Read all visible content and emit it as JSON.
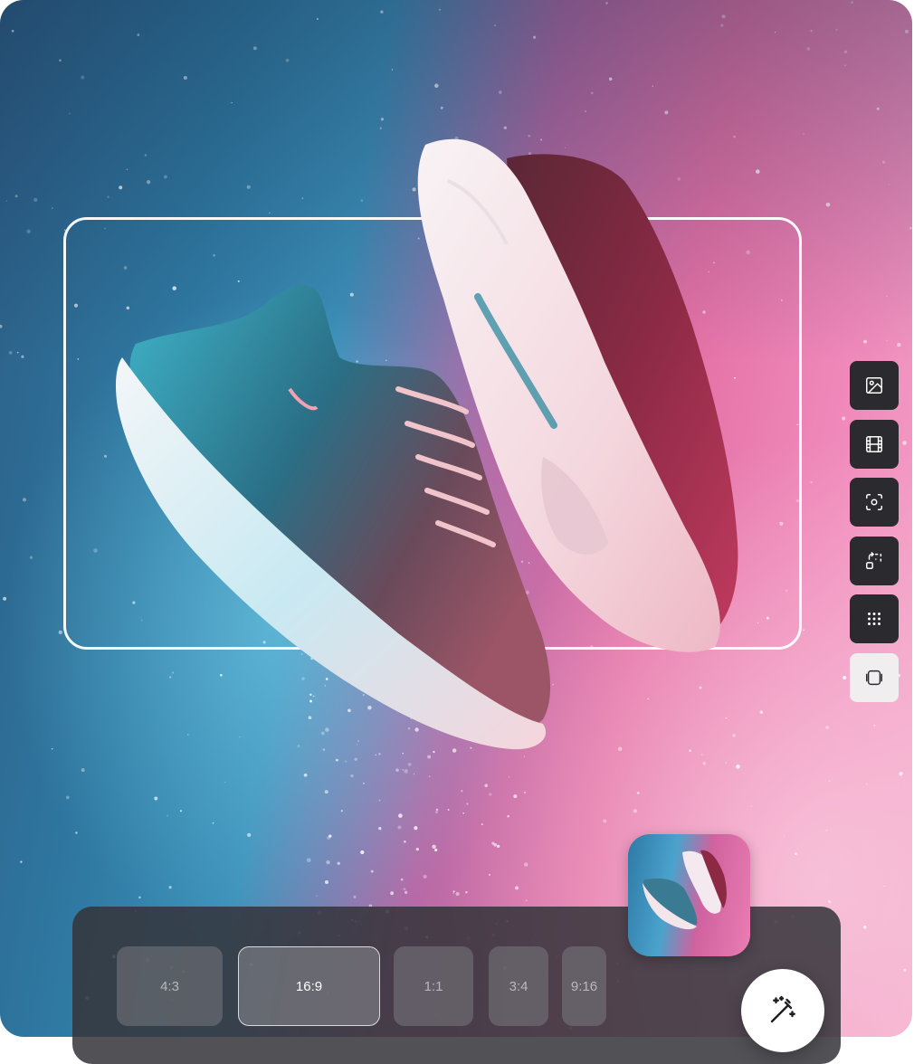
{
  "editor": {
    "tools": [
      {
        "name": "image-icon",
        "active": false
      },
      {
        "name": "film-icon",
        "active": false
      },
      {
        "name": "focus-icon",
        "active": false
      },
      {
        "name": "swap-frame-icon",
        "active": false
      },
      {
        "name": "grid-dots-icon",
        "active": false
      },
      {
        "name": "layers-icon",
        "active": true
      }
    ],
    "aspect_ratios": [
      {
        "label": "4:3",
        "selected": false
      },
      {
        "label": "16:9",
        "selected": true
      },
      {
        "label": "1:1",
        "selected": false
      },
      {
        "label": "3:4",
        "selected": false
      },
      {
        "label": "9:16",
        "selected": false
      }
    ],
    "magic_button_icon": "magic-wand-icon",
    "colors": {
      "bg_left": "#2f7aa3",
      "bg_right": "#e471a6",
      "toolbar_dark": "#2b2a2e",
      "bar": "#34343a"
    }
  }
}
